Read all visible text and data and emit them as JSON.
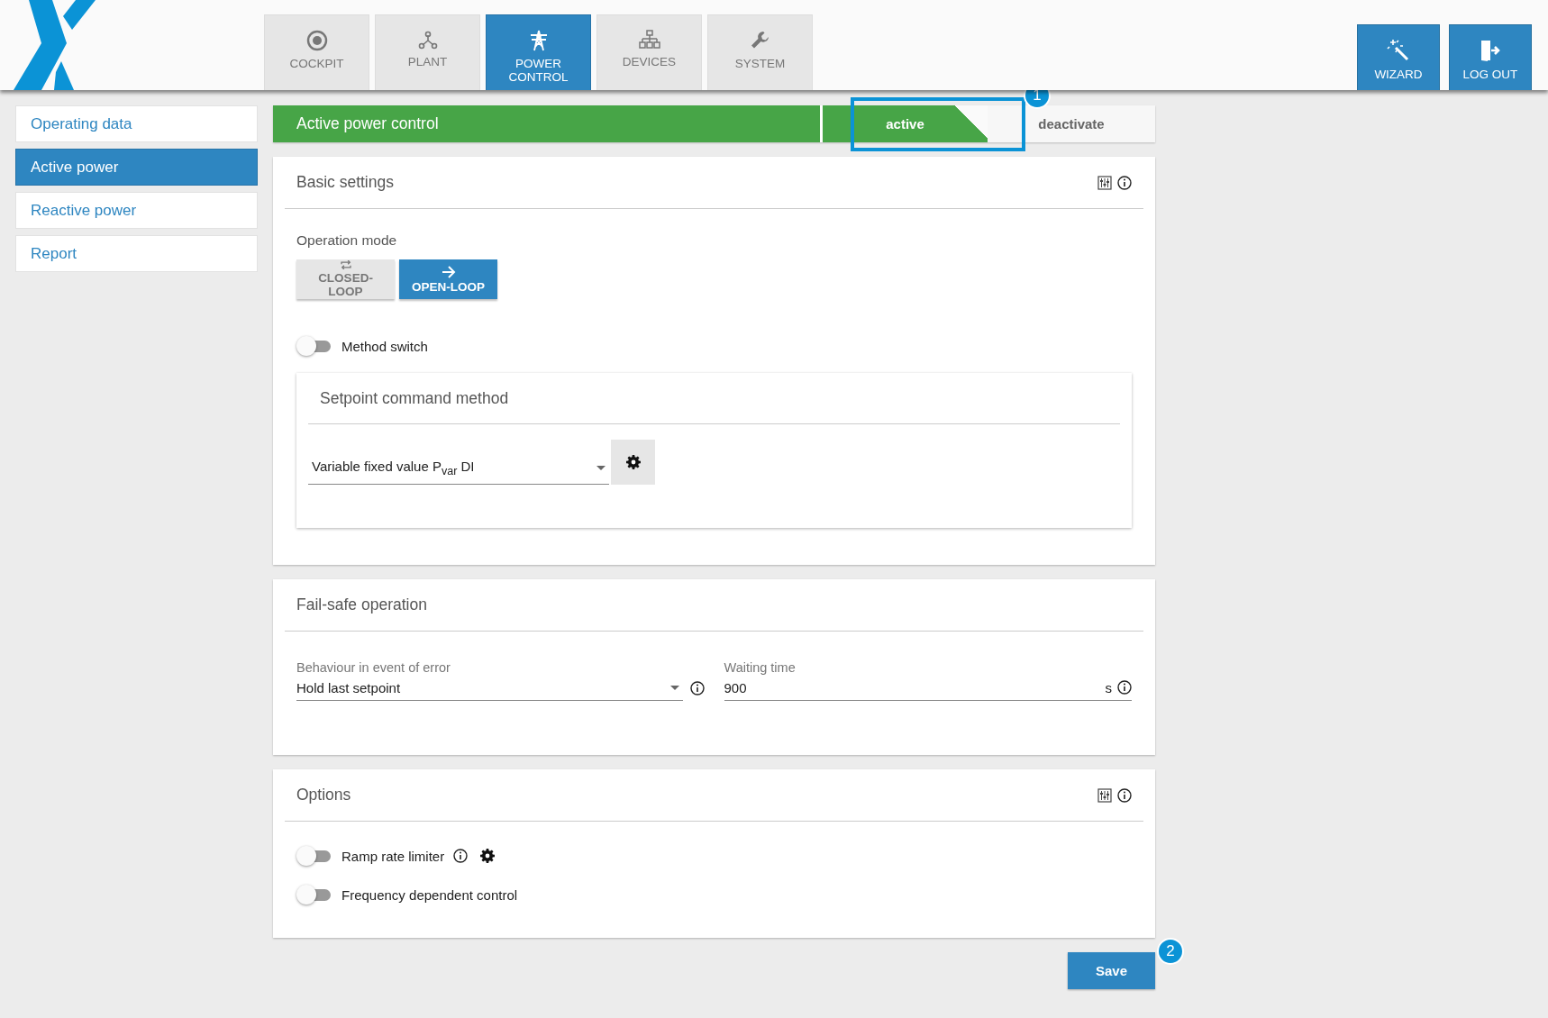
{
  "nav_tabs": [
    {
      "label": "COCKPIT",
      "kind": "cockpit",
      "selected": false
    },
    {
      "label": "PLANT",
      "kind": "plant",
      "selected": false
    },
    {
      "label": "POWER CONTROL",
      "kind": "power",
      "selected": true
    },
    {
      "label": "DEVICES",
      "kind": "devices",
      "selected": false
    },
    {
      "label": "SYSTEM",
      "kind": "system",
      "selected": false
    }
  ],
  "header_buttons": [
    {
      "label": "WIZARD",
      "kind": "wizard"
    },
    {
      "label": "LOG OUT",
      "kind": "logout"
    }
  ],
  "sidebar": {
    "items": [
      {
        "label": "Operating data",
        "selected": false
      },
      {
        "label": "Active power",
        "selected": true
      },
      {
        "label": "Reactive power",
        "selected": false
      },
      {
        "label": "Report",
        "selected": false
      }
    ]
  },
  "title_bar": {
    "title": "Active power control",
    "status_tabs": [
      {
        "label": "active",
        "selected": true
      },
      {
        "label": "deactivate",
        "selected": false
      }
    ]
  },
  "callouts": [
    {
      "label": "1"
    },
    {
      "label": "2"
    }
  ],
  "basic_settings": {
    "title": "Basic settings",
    "operation_mode": {
      "label": "Operation mode",
      "options": [
        {
          "label": "CLOSED-LOOP",
          "kind": "closed",
          "selected": false
        },
        {
          "label": "OPEN-LOOP",
          "kind": "open",
          "selected": true
        }
      ]
    },
    "method_switch": {
      "label": "Method switch",
      "on": false
    },
    "setpoint": {
      "title": "Setpoint command method",
      "value": "Variable fixed value P$_{var}$ DI"
    }
  },
  "fail_safe": {
    "title": "Fail-safe operation",
    "behaviour": {
      "label": "Behaviour in event of error",
      "value": "Hold last setpoint"
    },
    "waiting_time": {
      "label": "Waiting time",
      "value": "900",
      "unit": "s"
    }
  },
  "options": {
    "title": "Options",
    "items": [
      {
        "label": "Ramp rate limiter",
        "on": false,
        "kind": "with_settings"
      },
      {
        "label": "Frequency dependent control",
        "on": false,
        "kind": "plain"
      }
    ]
  },
  "save_button": "Save"
}
